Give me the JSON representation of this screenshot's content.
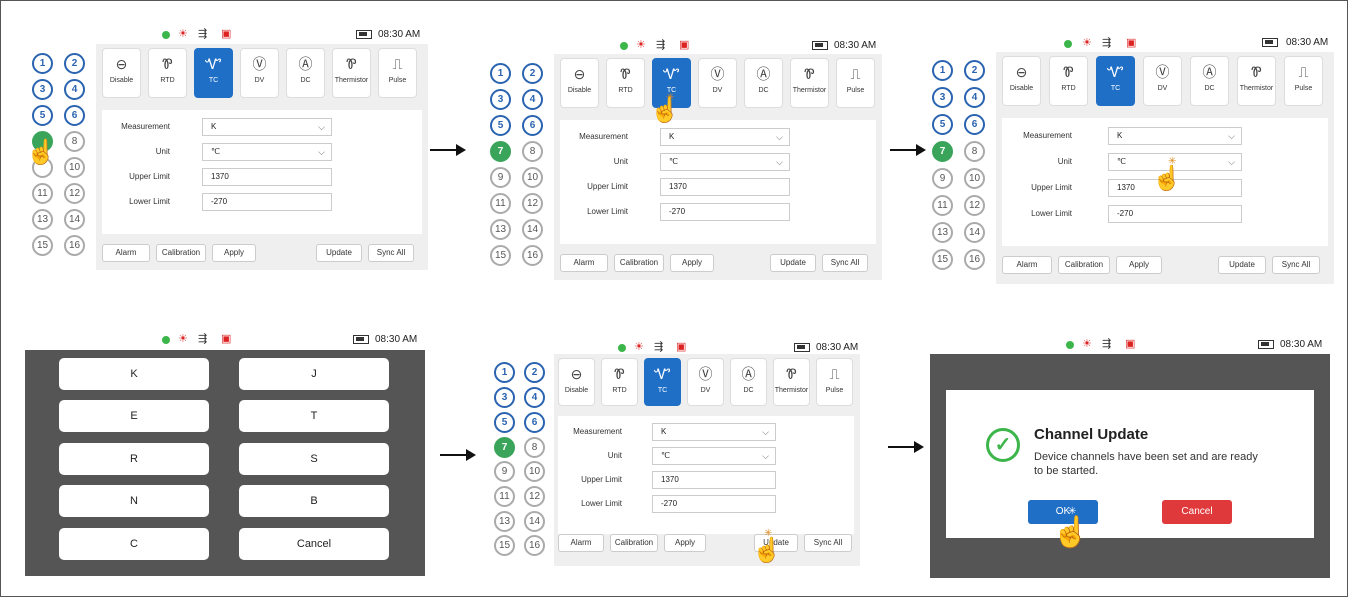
{
  "status": {
    "time": "08:30 AM",
    "warn_icon": "alert-icon",
    "usb_icon": "usb-icon",
    "log_icon": "log-icon",
    "battery_icon": "battery-icon"
  },
  "channels": [
    "1",
    "2",
    "3",
    "4",
    "5",
    "6",
    "7",
    "8",
    "9",
    "10",
    "11",
    "12",
    "13",
    "14",
    "15",
    "16"
  ],
  "modes": [
    {
      "label": "Disable",
      "icon": "⊖"
    },
    {
      "label": "RTD",
      "icon": "Ꮘ"
    },
    {
      "label": "TC",
      "icon": "Ꮙ"
    },
    {
      "label": "DV",
      "icon": "Ⓥ"
    },
    {
      "label": "DC",
      "icon": "Ⓐ"
    },
    {
      "label": "Thermistor",
      "icon": "Ꮘ"
    },
    {
      "label": "Pulse",
      "icon": "⎍"
    }
  ],
  "form": {
    "measurement_label": "Measurement",
    "measurement_value": "K",
    "unit_label": "Unit",
    "unit_value": "℃",
    "upper_label": "Upper Limit",
    "upper_value": "1370",
    "lower_label": "Lower Limit",
    "lower_value": "-270"
  },
  "buttons": {
    "alarm": "Alarm",
    "calibration": "Calibration",
    "apply": "Apply",
    "update": "Update",
    "sync_all": "Sync All"
  },
  "keypad": [
    "K",
    "J",
    "E",
    "T",
    "R",
    "S",
    "N",
    "B",
    "C",
    "Cancel"
  ],
  "dialog": {
    "title": "Channel Update",
    "message_line1": "Device channels have been set and are ready",
    "message_line2": "to be started.",
    "ok": "OK",
    "cancel": "Cancel",
    "ok_color": "#1f6fc6",
    "cancel_color": "#e0393b"
  }
}
